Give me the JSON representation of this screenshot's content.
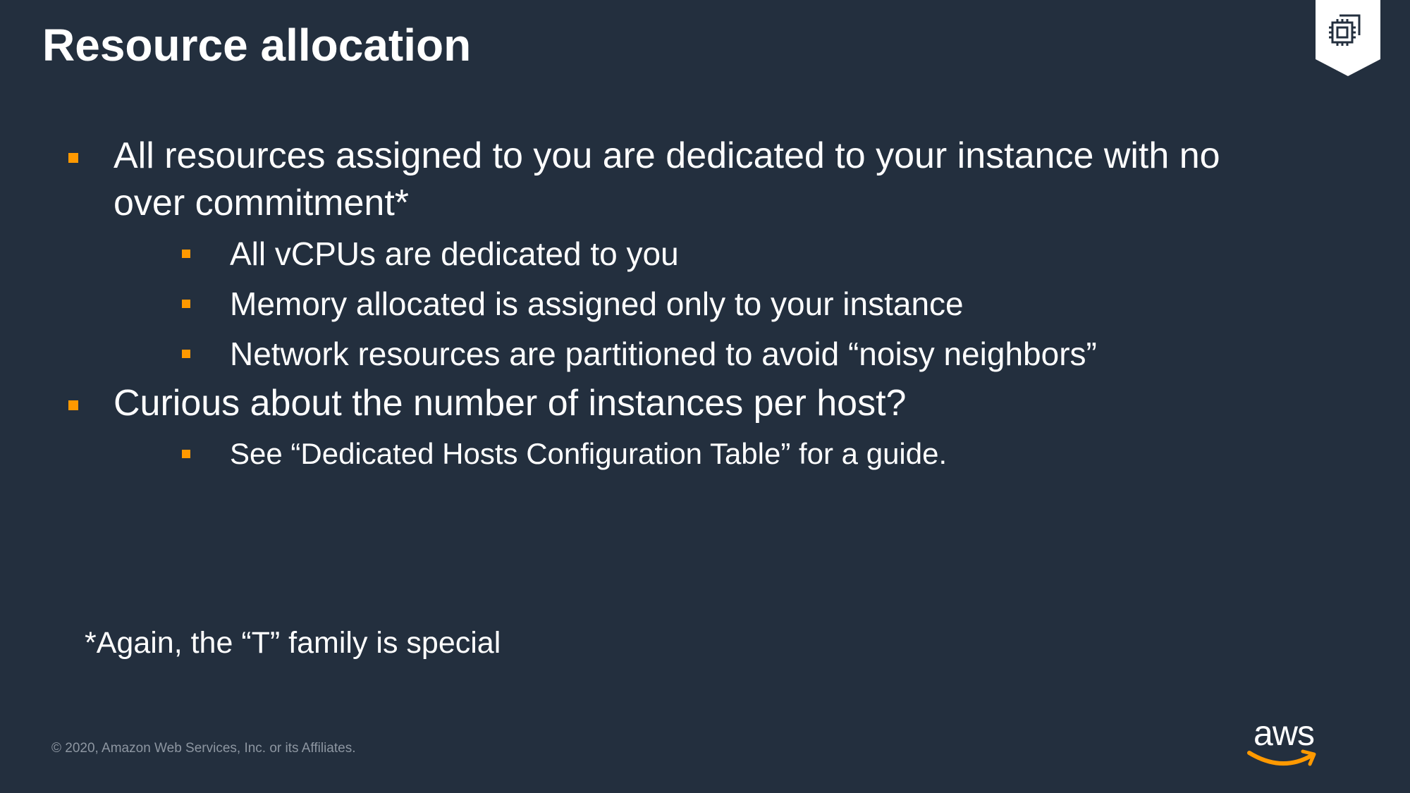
{
  "slide": {
    "title": "Resource allocation",
    "badge_icon": "processor-chip-icon",
    "bullets": [
      {
        "lines": [
          "All resources assigned to you are dedicated to your instance with no",
          "over commitment*"
        ],
        "sub": [
          "All vCPUs are dedicated to you",
          "Memory allocated is assigned only to your instance",
          "Network resources are partitioned to avoid “noisy neighbors”"
        ]
      },
      {
        "lines": [
          "Curious about the number of instances per host?"
        ],
        "sub": [
          "See “Dedicated Hosts Configuration Table” for a guide."
        ]
      }
    ],
    "note": "*Again, the “T” family is special"
  },
  "footer": {
    "copyright": "© 2020, Amazon Web Services, Inc. or its Affiliates.",
    "logo_text": "aws"
  },
  "colors": {
    "background": "#232f3e",
    "accent": "#ff9900",
    "text": "#ffffff",
    "muted": "#8d96a1"
  }
}
